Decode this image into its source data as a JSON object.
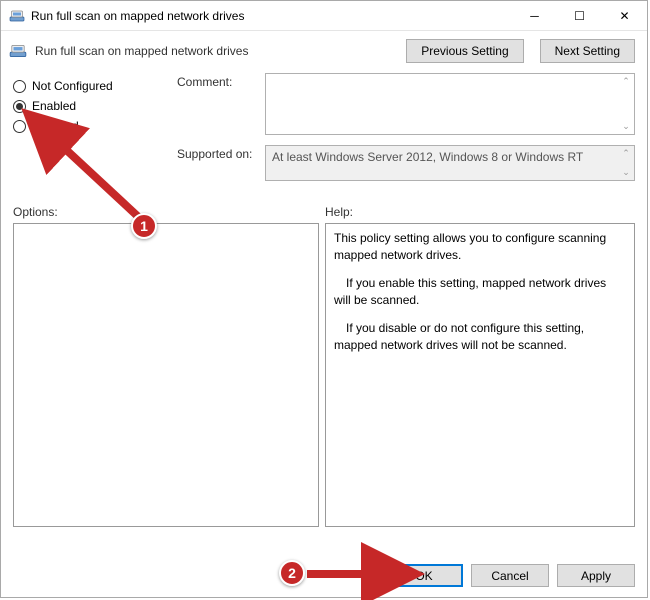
{
  "window": {
    "title": "Run full scan on mapped network drives"
  },
  "header": {
    "policy_title": "Run full scan on mapped network drives",
    "prev_button": "Previous Setting",
    "next_button": "Next Setting"
  },
  "state": {
    "not_configured_label": "Not Configured",
    "enabled_label": "Enabled",
    "disabled_label": "Disabled",
    "selected": "enabled"
  },
  "fields": {
    "comment_label": "Comment:",
    "comment_value": "",
    "supported_label": "Supported on:",
    "supported_value": "At least Windows Server 2012, Windows 8 or Windows RT"
  },
  "lower": {
    "options_label": "Options:",
    "help_label": "Help:",
    "help_p1": "This policy setting allows you to configure scanning mapped network drives.",
    "help_p2": "If you enable this setting, mapped network drives will be scanned.",
    "help_p3": "If you disable or do not configure this setting, mapped network drives will not be scanned."
  },
  "footer": {
    "ok": "OK",
    "cancel": "Cancel",
    "apply": "Apply"
  },
  "callouts": {
    "c1": "1",
    "c2": "2"
  }
}
